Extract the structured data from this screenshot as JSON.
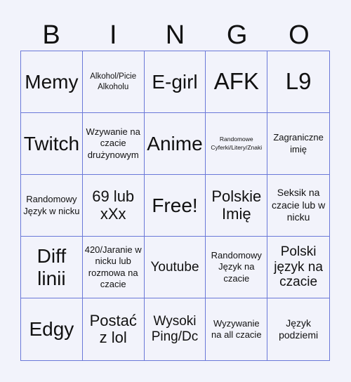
{
  "header": {
    "letters": [
      "B",
      "I",
      "N",
      "G",
      "O"
    ]
  },
  "colors": {
    "background": "#f2f3fb",
    "grid_line": "#6a78d8",
    "text": "#111111"
  },
  "cells": [
    {
      "text": "Memy",
      "size": "s-l"
    },
    {
      "text": "Alkohol/Picie Alkoholu",
      "size": "s-xxs"
    },
    {
      "text": "E-girl",
      "size": "s-l"
    },
    {
      "text": "AFK",
      "size": "s-xl"
    },
    {
      "text": "L9",
      "size": "s-xl"
    },
    {
      "text": "Twitch",
      "size": "s-l"
    },
    {
      "text": "Wzywanie na czacie drużynowym",
      "size": "s-xs"
    },
    {
      "text": "Anime",
      "size": "s-l"
    },
    {
      "text": "Randomowe Cyferki/Litery/Znaki",
      "size": "s-tiny"
    },
    {
      "text": "Zagraniczne imię",
      "size": "s-xs"
    },
    {
      "text": "Randomowy Język w nicku",
      "size": "s-xs"
    },
    {
      "text": "69 lub xXx",
      "size": "s-ml"
    },
    {
      "text": "Free!",
      "size": "s-l"
    },
    {
      "text": "Polskie Imię",
      "size": "s-ml"
    },
    {
      "text": "Seksik na czacie lub w nicku",
      "size": "s-s"
    },
    {
      "text": "Diff linii",
      "size": "s-l"
    },
    {
      "text": "420/Jaranie w nicku lub rozmowa na czacie",
      "size": "s-xs"
    },
    {
      "text": "Youtube",
      "size": "s-m"
    },
    {
      "text": "Randomowy Język na czacie",
      "size": "s-xs"
    },
    {
      "text": "Polski język na czacie",
      "size": "s-m"
    },
    {
      "text": "Edgy",
      "size": "s-l"
    },
    {
      "text": "Postać z lol",
      "size": "s-ml"
    },
    {
      "text": "Wysoki Ping/Dc",
      "size": "s-m"
    },
    {
      "text": "Wyzywanie na all czacie",
      "size": "s-xs"
    },
    {
      "text": "Język podziemi",
      "size": "s-s"
    }
  ]
}
